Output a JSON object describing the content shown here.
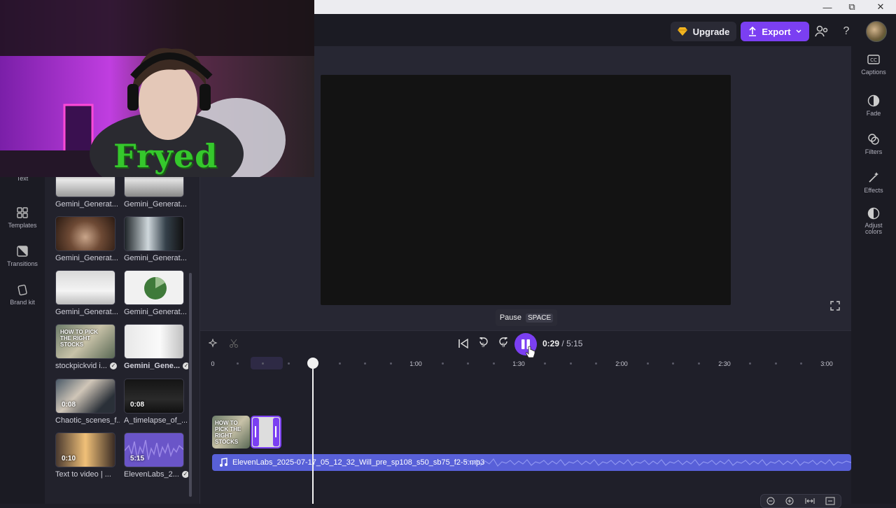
{
  "header": {
    "upgrade_label": "Upgrade",
    "export_label": "Export",
    "help_label": "?"
  },
  "window": {
    "minimize": "—",
    "restore": "⧉",
    "close": "✕"
  },
  "left_rail": {
    "items": [
      {
        "label": "Text",
        "icon": "text-icon"
      },
      {
        "label": "Templates",
        "icon": "templates-icon"
      },
      {
        "label": "Transitions",
        "icon": "transitions-icon"
      },
      {
        "label": "Brand kit",
        "icon": "brand-kit-icon"
      }
    ]
  },
  "media": {
    "items": [
      {
        "label": "Gemini_Generat...",
        "duration": ""
      },
      {
        "label": "Gemini_Generat...",
        "duration": ""
      },
      {
        "label": "Gemini_Generat...",
        "duration": ""
      },
      {
        "label": "Gemini_Generat...",
        "duration": ""
      },
      {
        "label": "Gemini_Generat...",
        "duration": ""
      },
      {
        "label": "Gemini_Generat...",
        "duration": ""
      },
      {
        "label": "stockpickvid i...",
        "duration": "",
        "thumb_text": "HOW TO PICK THE RIGHT STOCKS"
      },
      {
        "label": "Gemini_Gene...",
        "duration": ""
      },
      {
        "label": "Chaotic_scenes_f...",
        "duration": "0:08"
      },
      {
        "label": "A_timelapse_of_...",
        "duration": "0:08"
      },
      {
        "label": "Text to video  |  ...",
        "duration": "0:10"
      },
      {
        "label": "ElevenLabs_2...",
        "duration": "5:15"
      }
    ]
  },
  "webcam": {
    "overlay_text": "Fryed"
  },
  "right_rail": {
    "items": [
      {
        "label": "Captions",
        "icon": "captions-icon"
      },
      {
        "label": "Fade",
        "icon": "fade-icon"
      },
      {
        "label": "Filters",
        "icon": "filters-icon"
      },
      {
        "label": "Effects",
        "icon": "effects-icon"
      },
      {
        "label": "Adjust colors",
        "icon": "adjust-colors-icon"
      }
    ]
  },
  "tooltip": {
    "label": "Pause",
    "shortcut": "SPACE"
  },
  "playback": {
    "current": "0:29",
    "separator": "/",
    "total": "5:15",
    "rewind_label": "5",
    "forward_label": "5"
  },
  "timeline": {
    "ruler_labels": [
      "0",
      "1:00",
      "1:30",
      "2:00",
      "2:30",
      "3:00"
    ],
    "audio_clip_label": "ElevenLabs_2025-07-17_05_12_32_Will_pre_sp108_s50_sb75_f2-5.mp3",
    "video_clip_text": "HOW TO PICK THE RIGHT STOCKS"
  },
  "colors": {
    "accent": "#7b3ff2",
    "audio_track": "#5860d8",
    "background": "#1e1e27"
  }
}
